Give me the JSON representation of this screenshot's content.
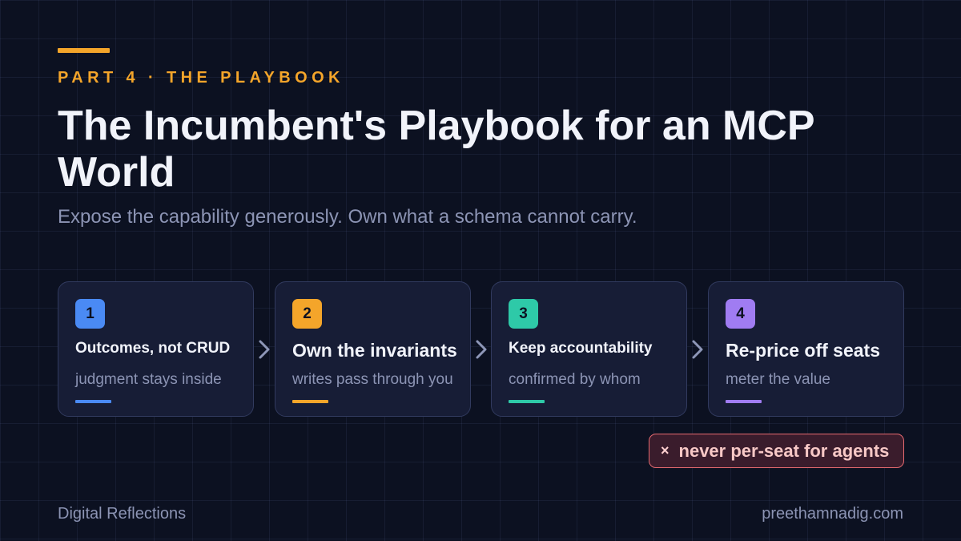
{
  "header": {
    "eyebrow": "PART 4 · THE PLAYBOOK",
    "title": "The Incumbent's Playbook for an MCP World",
    "subtitle": "Expose the capability generously. Own what a schema cannot carry."
  },
  "steps": [
    {
      "number": "1",
      "title": "Outcomes, not CRUD",
      "subtitle": "judgment stays inside",
      "color": "#4a8af4"
    },
    {
      "number": "2",
      "title": "Own the invariants",
      "subtitle": "writes pass through you",
      "color": "#f4a52a"
    },
    {
      "number": "3",
      "title": "Keep accountability",
      "subtitle": "confirmed by whom",
      "color": "#2ec9a8"
    },
    {
      "number": "4",
      "title": "Re-price off seats",
      "subtitle": "meter the value",
      "color": "#a07cf2"
    }
  ],
  "connector_icon": "chevron-right-icon",
  "warning": {
    "icon": "close-icon",
    "symbol": "×",
    "text": "never per-seat for agents"
  },
  "footer": {
    "left": "Digital Reflections",
    "right": "preethamnadig.com"
  },
  "colors": {
    "background": "#0c1121",
    "accent": "#f4a52a",
    "card_background": "#171d36",
    "warning_border": "#e56a70"
  }
}
